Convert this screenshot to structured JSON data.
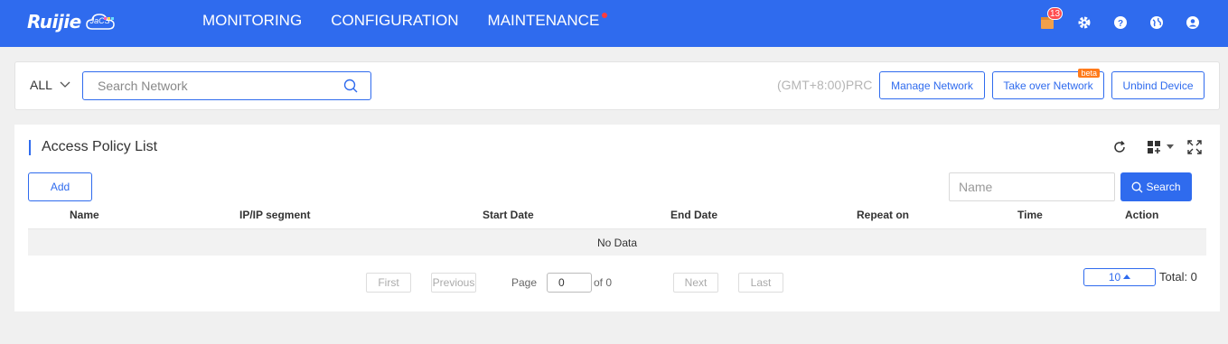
{
  "header": {
    "logo_text": "Ruijie",
    "logo_sub": "JaCS",
    "nav": [
      "MONITORING",
      "CONFIGURATION",
      "MAINTENANCE"
    ],
    "notification_count": "13",
    "icons": [
      "notification-icon",
      "settings-icon",
      "help-icon",
      "globe-icon",
      "user-icon"
    ]
  },
  "filter": {
    "scope": "ALL",
    "search_placeholder": "Search Network",
    "timezone": "(GMT+8:00)PRC",
    "buttons": {
      "manage": "Manage Network",
      "takeover": "Take over Network",
      "takeover_badge": "beta",
      "unbind": "Unbind Device"
    }
  },
  "panel": {
    "title": "Access Policy List",
    "add_label": "Add",
    "name_placeholder": "Name",
    "search_label": "Search",
    "columns": [
      "Name",
      "IP/IP segment",
      "Start Date",
      "End Date",
      "Repeat on",
      "Time",
      "Action"
    ],
    "empty_text": "No Data"
  },
  "pagination": {
    "first": "First",
    "previous": "Previous",
    "page_label": "Page",
    "page_value": "0",
    "of_label": "of 0",
    "next": "Next",
    "last": "Last",
    "page_size": "10",
    "total": "Total: 0"
  },
  "colors": {
    "primary": "#2f6bee",
    "badge": "#ff4d4f",
    "beta": "#ff7a1a"
  }
}
